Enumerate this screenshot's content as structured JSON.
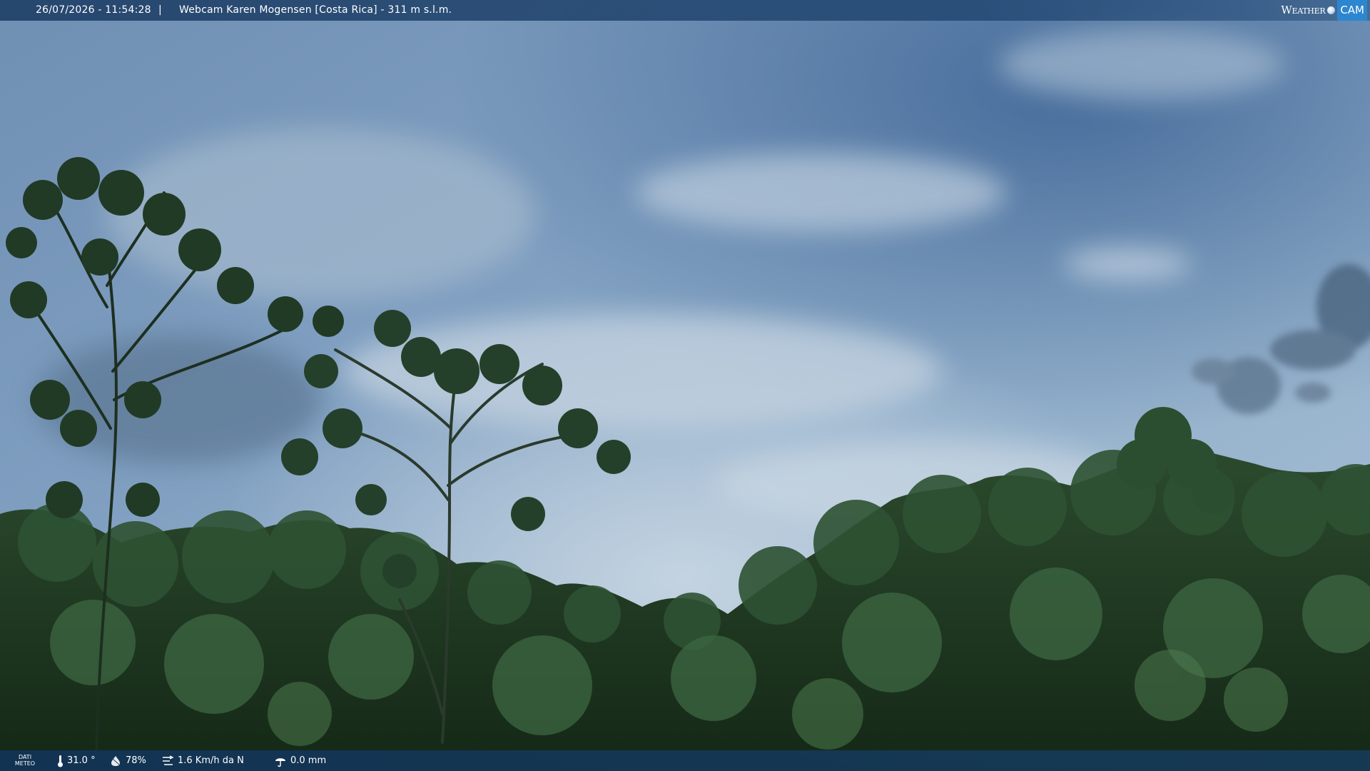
{
  "header": {
    "datetime": "26/07/2026 - 11:54:28",
    "separator": "|",
    "title": "Webcam Karen Mogensen [Costa Rica]  - 311 m s.l.m."
  },
  "brand": {
    "part1": "Weather",
    "part2": "CAM",
    "accent_color": "#2d86d0"
  },
  "weather_bar": {
    "label_line1": "DATI",
    "label_line2": "METEO",
    "temperature": "31.0 °",
    "humidity": "78%",
    "wind": "1.6 Km/h da N",
    "rain": "0.0 mm",
    "icons": [
      "thermometer-icon",
      "humidity-icon",
      "wind-icon",
      "rain-icon"
    ]
  },
  "colors": {
    "sky_top": "#3e6590",
    "sky_bottom": "#aec3d6",
    "foliage": "#1f3a22",
    "bar": "#1c4270"
  }
}
